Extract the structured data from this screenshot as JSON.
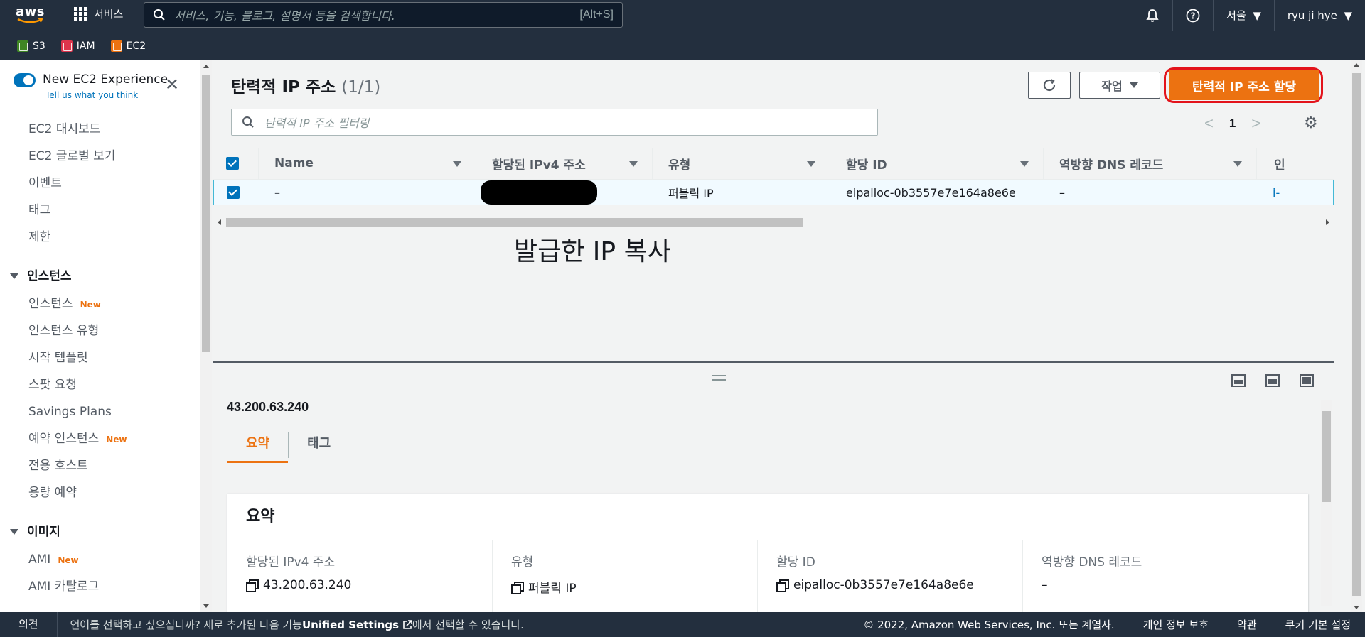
{
  "topnav": {
    "logo": "aws",
    "services_label": "서비스",
    "search_placeholder": "서비스, 기능, 블로그, 설명서 등을 검색합니다.",
    "search_shortcut": "[Alt+S]",
    "region": "서울",
    "user": "ryu ji hye"
  },
  "favorites": [
    {
      "label": "S3",
      "color": "#3f8624"
    },
    {
      "label": "IAM",
      "color": "#dd344c"
    },
    {
      "label": "EC2",
      "color": "#ec7211"
    }
  ],
  "sidebar": {
    "toggle_title": "New EC2 Experience",
    "toggle_sub": "Tell us what you think",
    "top_items": [
      "EC2 대시보드",
      "EC2 글로벌 보기",
      "이벤트",
      "태그",
      "제한"
    ],
    "sections": [
      {
        "title": "인스턴스",
        "items": [
          {
            "label": "인스턴스",
            "badge": "New"
          },
          {
            "label": "인스턴스 유형",
            "badge": ""
          },
          {
            "label": "시작 템플릿",
            "badge": ""
          },
          {
            "label": "스팟 요청",
            "badge": ""
          },
          {
            "label": "Savings Plans",
            "badge": ""
          },
          {
            "label": "예약 인스턴스",
            "badge": "New"
          },
          {
            "label": "전용 호스트",
            "badge": ""
          },
          {
            "label": "용량 예약",
            "badge": ""
          }
        ]
      },
      {
        "title": "이미지",
        "items": [
          {
            "label": "AMI",
            "badge": "New"
          },
          {
            "label": "AMI 카탈로그",
            "badge": ""
          }
        ]
      }
    ]
  },
  "main": {
    "title": "탄력적 IP 주소",
    "count": "(1/1)",
    "action_label": "작업",
    "allocate_label": "탄력적 IP 주소 할당",
    "filter_placeholder": "탄력적 IP 주소 필터링",
    "page": "1",
    "columns": [
      "Name",
      "할당된 IPv4 주소",
      "유형",
      "할당 ID",
      "역방향 DNS 레코드",
      "인"
    ],
    "row": {
      "name": "–",
      "ipv4": "",
      "type": "퍼블릭 IP",
      "allocation_id": "eipalloc-0b3557e7e164a8e6e",
      "reverse_dns": "–",
      "extra": "i-"
    },
    "annotation": "발급한 IP 복사"
  },
  "details": {
    "ip": "43.200.63.240",
    "tabs": [
      "요약",
      "태그"
    ],
    "panel_title": "요약",
    "fields": [
      {
        "label": "할당된 IPv4 주소",
        "value": "43.200.63.240",
        "copy": true
      },
      {
        "label": "유형",
        "value": "퍼블릭 IP",
        "copy": true
      },
      {
        "label": "할당 ID",
        "value": "eipalloc-0b3557e7e164a8e6e",
        "copy": true
      },
      {
        "label": "역방향 DNS 레코드",
        "value": "–",
        "copy": false
      }
    ]
  },
  "footer": {
    "feedback": "의견",
    "msg_prefix": "언어를 선택하고 싶으십니까? 새로 추가된 다음 기능",
    "msg_link": "Unified Settings",
    "msg_suffix": "에서 선택할 수 있습니다.",
    "copyright": "© 2022, Amazon Web Services, Inc. 또는 계열사.",
    "privacy": "개인 정보 보호",
    "terms": "약관",
    "cookies": "쿠키 기본 설정"
  }
}
